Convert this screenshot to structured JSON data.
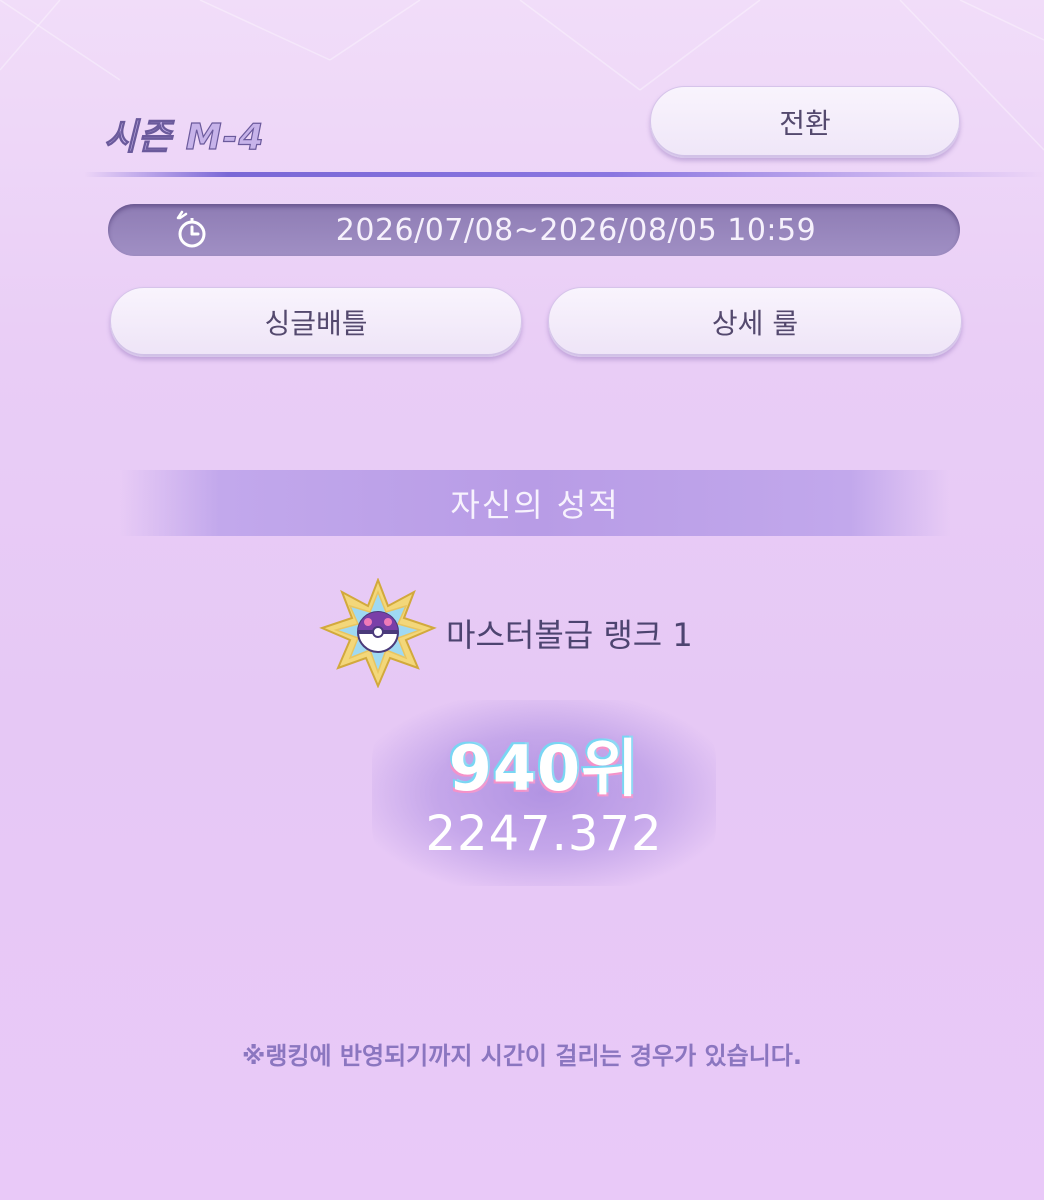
{
  "header": {
    "season_title": "시즌 M-4",
    "switch_label": "전환"
  },
  "season": {
    "period": "2026/07/08~2026/08/05 10:59"
  },
  "buttons": {
    "single_battle": "싱글배틀",
    "detailed_rules": "상세 룰"
  },
  "results": {
    "section_title": "자신의 성적",
    "rank_label": "마스터볼급 랭크 1",
    "place": "940위",
    "score": "2247.372"
  },
  "footnote": "※랭킹에 반영되기까지 시간이 걸리는 경우가 있습니다.",
  "icons": {
    "clock": "stopwatch-icon",
    "badge": "master-ball-rank-badge"
  },
  "colors": {
    "accent": "#7a67d6",
    "text_dark": "#54496e",
    "banner": "#b89ce6"
  }
}
